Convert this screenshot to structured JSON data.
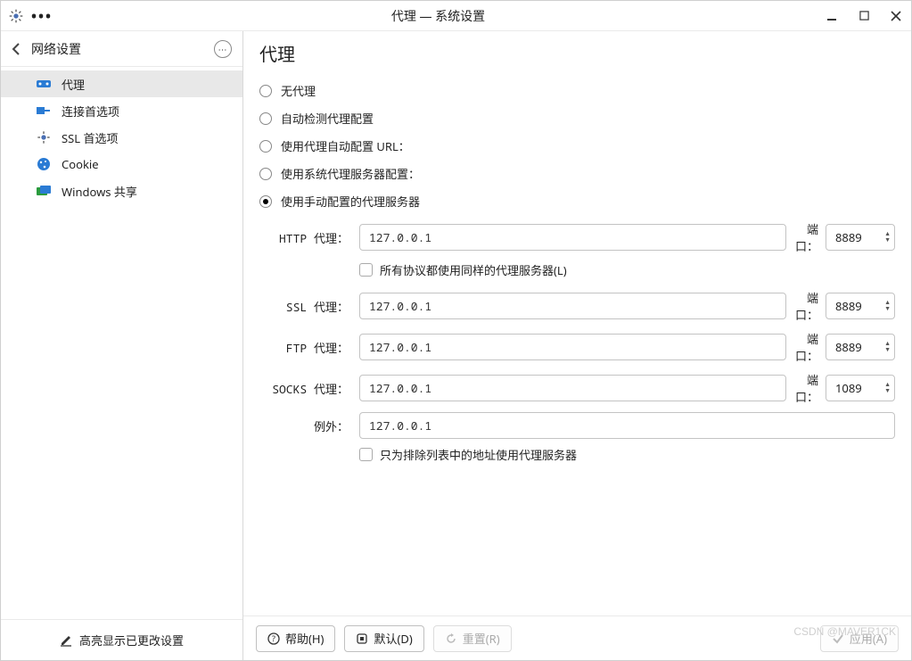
{
  "window_title": "代理 — 系统设置",
  "sidebar": {
    "header_label": "网络设置",
    "items": [
      {
        "label": "代理",
        "icon": "proxy",
        "selected": true
      },
      {
        "label": "连接首选项",
        "icon": "connection"
      },
      {
        "label": "SSL 首选项",
        "icon": "ssl"
      },
      {
        "label": "Cookie",
        "icon": "cookie"
      },
      {
        "label": "Windows 共享",
        "icon": "share"
      }
    ],
    "footer_label": "高亮显示已更改设置"
  },
  "content": {
    "title": "代理",
    "radios": [
      {
        "label": "无代理",
        "checked": false
      },
      {
        "label": "自动检测代理配置",
        "checked": false
      },
      {
        "label": "使用代理自动配置 URL：",
        "checked": false
      },
      {
        "label": "使用系统代理服务器配置：",
        "checked": false
      },
      {
        "label": "使用手动配置的代理服务器",
        "checked": true
      }
    ],
    "port_label": "端口：",
    "fields": {
      "http": {
        "label": "HTTP 代理：",
        "value": "127.0.0.1",
        "port": "8889"
      },
      "ssl": {
        "label": "SSL 代理：",
        "value": "127.0.0.1",
        "port": "8889"
      },
      "ftp": {
        "label": "FTP 代理：",
        "value": "127.0.0.1",
        "port": "8889"
      },
      "socks": {
        "label": "SOCKS 代理：",
        "value": "127.0.0.1",
        "port": "1089"
      },
      "except": {
        "label": "例外：",
        "value": "127.0.0.1"
      }
    },
    "same_protocol_label": "所有协议都使用同样的代理服务器(L)",
    "except_only_label": "只为排除列表中的地址使用代理服务器"
  },
  "footer": {
    "help": "帮助(H)",
    "defaults": "默认(D)",
    "reset": "重置(R)",
    "apply": "应用(A)"
  },
  "watermark": "CSDN @MAVER1CK"
}
